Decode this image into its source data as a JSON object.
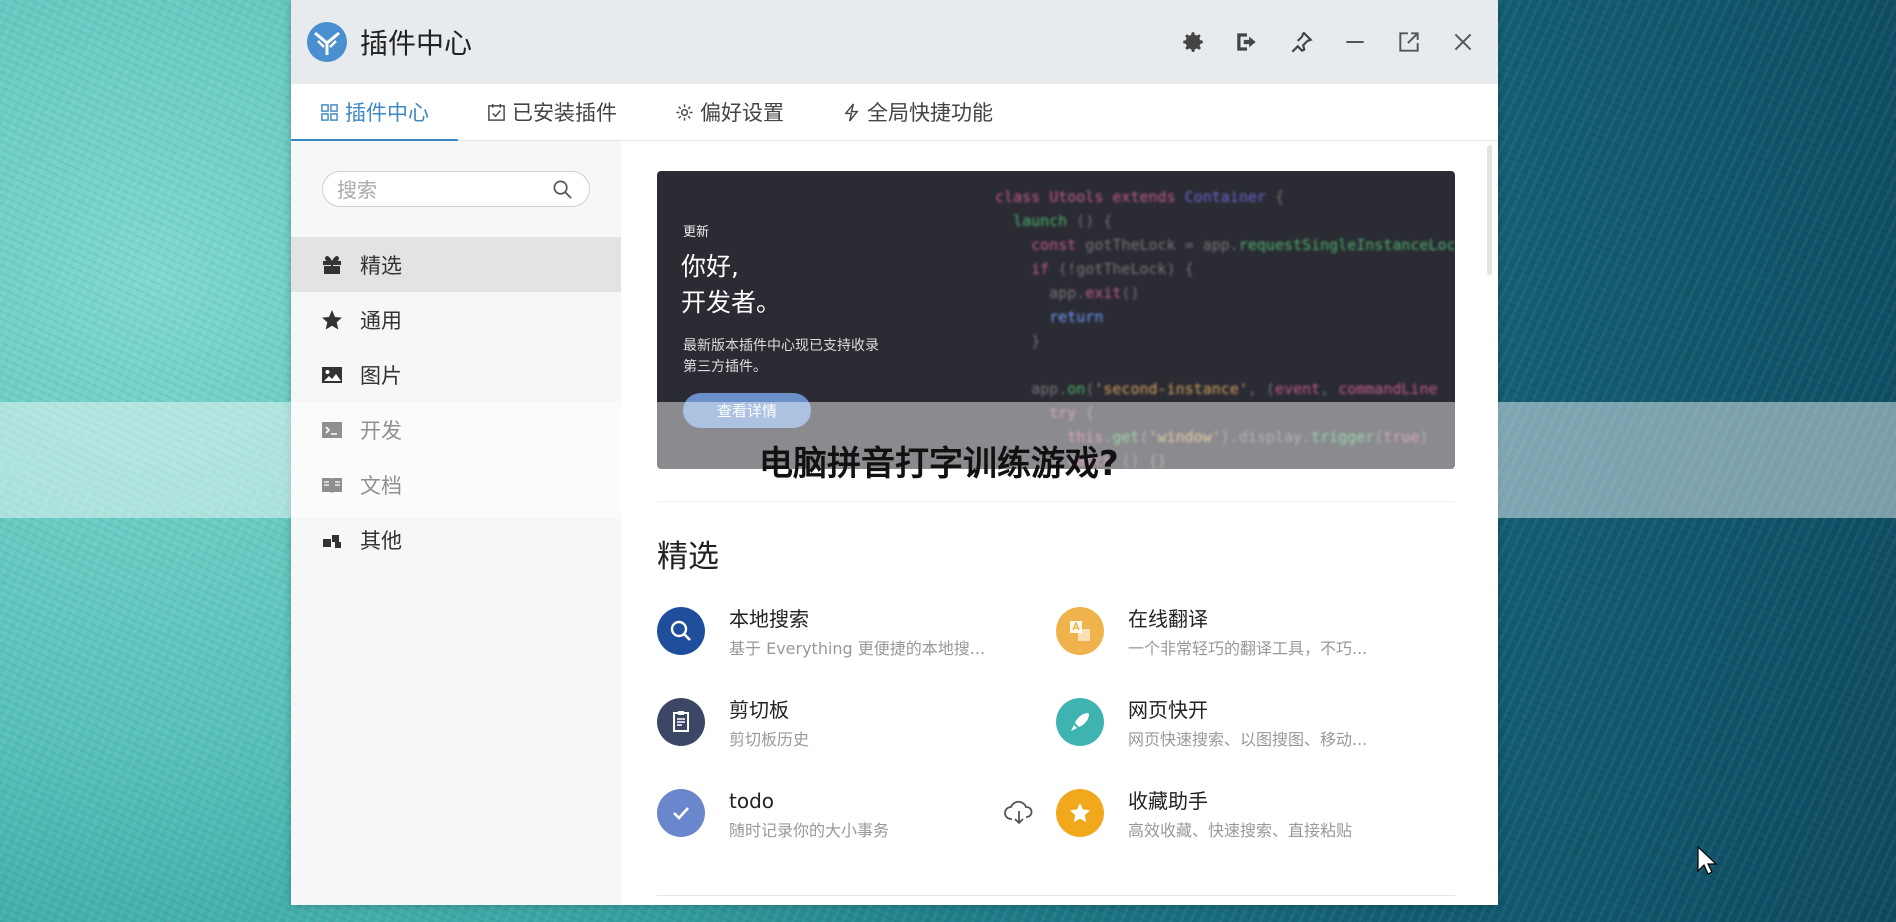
{
  "window": {
    "title": "插件中心"
  },
  "tabs": [
    {
      "label": "插件中心",
      "icon": "grid-icon"
    },
    {
      "label": "已安装插件",
      "icon": "calendar-check-icon"
    },
    {
      "label": "偏好设置",
      "icon": "gear-icon"
    },
    {
      "label": "全局快捷功能",
      "icon": "lightning-icon"
    }
  ],
  "sidebar": {
    "search_placeholder": "搜索",
    "items": [
      {
        "label": "精选",
        "icon": "gift-icon"
      },
      {
        "label": "通用",
        "icon": "star-icon"
      },
      {
        "label": "图片",
        "icon": "image-icon"
      },
      {
        "label": "开发",
        "icon": "terminal-icon"
      },
      {
        "label": "文档",
        "icon": "book-icon"
      },
      {
        "label": "其他",
        "icon": "blocks-icon"
      }
    ]
  },
  "banner": {
    "tag": "更新",
    "title_line1": "你好,",
    "title_line2": "开发者。",
    "desc_line1": "最新版本插件中心现已支持收录",
    "desc_line2": "第三方插件。",
    "button_label": "查看详情"
  },
  "featured": {
    "title": "精选",
    "plugins": [
      {
        "name": "本地搜索",
        "desc": "基于 Everything 更便捷的本地搜...",
        "icon": "magnifier-icon",
        "color": "#1f4e9c"
      },
      {
        "name": "在线翻译",
        "desc": "一个非常轻巧的翻译工具，不巧...",
        "icon": "translate-icon",
        "color": "#f0b24a"
      },
      {
        "name": "剪切板",
        "desc": "剪切板历史",
        "icon": "clipboard-icon",
        "color": "#3c4766"
      },
      {
        "name": "网页快开",
        "desc": "网页快速搜索、以图搜图、移动...",
        "icon": "rocket-icon",
        "color": "#3fb3b0"
      },
      {
        "name": "todo",
        "desc": "随时记录你的大小事务",
        "icon": "check-icon",
        "color": "#6a86cc"
      },
      {
        "name": "收藏助手",
        "desc": "高效收藏、快速搜索、直接粘贴",
        "icon": "star-badge-icon",
        "color": "#f2a81d"
      }
    ]
  },
  "overlay": {
    "text": "电脑拼音打字训练游戏?"
  }
}
